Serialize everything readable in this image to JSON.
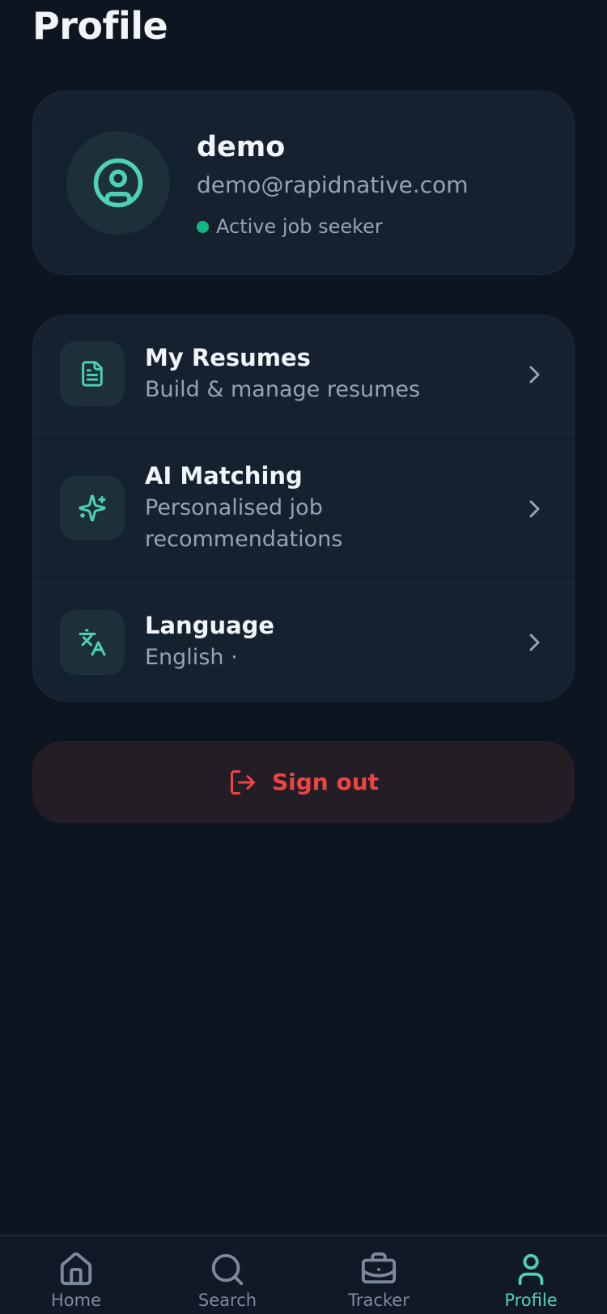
{
  "header": {
    "title": "Profile"
  },
  "profile": {
    "name": "demo",
    "email": "demo@rapidnative.com",
    "status": "Active job seeker",
    "avatar_icon": "user-circle-icon"
  },
  "menu": {
    "items": [
      {
        "title": "My Resumes",
        "subtitle": "Build & manage resumes",
        "icon": "file-text-icon"
      },
      {
        "title": "AI Matching",
        "subtitle": "Personalised job recommendations",
        "icon": "sparkles-icon"
      },
      {
        "title": "Language",
        "subtitle": "English ·",
        "icon": "languages-icon"
      }
    ]
  },
  "signout": {
    "label": "Sign out",
    "icon": "log-out-icon"
  },
  "tabbar": {
    "tabs": [
      {
        "label": "Home",
        "icon": "home-icon",
        "active": false
      },
      {
        "label": "Search",
        "icon": "search-icon",
        "active": false
      },
      {
        "label": "Tracker",
        "icon": "briefcase-icon",
        "active": false
      },
      {
        "label": "Profile",
        "icon": "user-icon",
        "active": true
      }
    ]
  },
  "colors": {
    "background": "#0d1520",
    "card": "#15212f",
    "accent": "#4fd1b5",
    "status_dot": "#10b981",
    "danger": "#ef4444",
    "muted_text": "#94a3b8"
  }
}
